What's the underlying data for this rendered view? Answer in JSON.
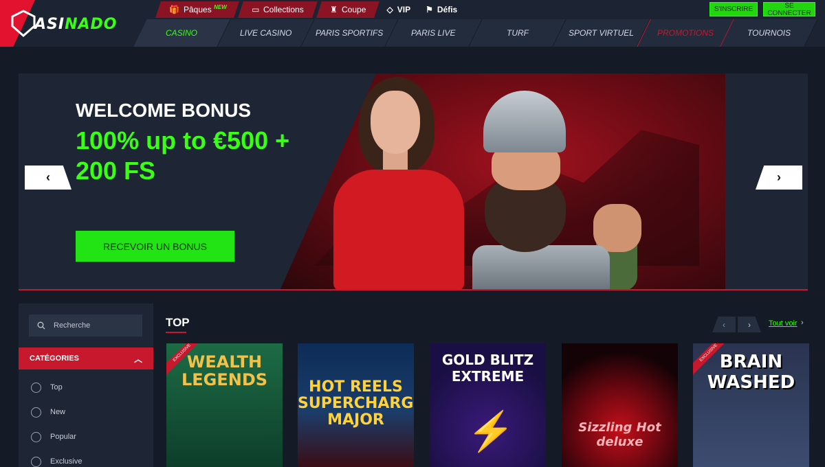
{
  "brand": {
    "logo_text_white": "C",
    "logo_text_main": "ASI",
    "logo_text_green": "NADO",
    "accent": "#39ff14",
    "red": "#c8182d"
  },
  "topbar": [
    {
      "label": "Pâques",
      "badge": "NEW",
      "icon": "gift-icon"
    },
    {
      "label": "Collections",
      "icon": "book-icon"
    },
    {
      "label": "Coupe",
      "icon": "trophy-icon"
    }
  ],
  "topplain": [
    {
      "label": "VIP",
      "icon": "diamond-icon"
    },
    {
      "label": "Défis",
      "icon": "flag-icon"
    }
  ],
  "auth": {
    "signup": "S'INSCRIRE",
    "login": "SE CONNECTER"
  },
  "nav": [
    "CASINO",
    "LIVE CASINO",
    "PARIS SPORTIFS",
    "PARIS LIVE",
    "TURF",
    "SPORT VIRTUEL",
    "PROMOTIONS",
    "TOURNOIS"
  ],
  "banner": {
    "title": "WELCOME BONUS",
    "offer": "100% up to €500 + 200 FS",
    "cta": "RECEVOIR UN BONUS",
    "prev": "‹",
    "next": "›",
    "active_slide": 1,
    "slides": 3
  },
  "sidebar": {
    "search_placeholder": "Recherche",
    "categories_label": "CATÉGORIES",
    "items": [
      "Top",
      "New",
      "Popular",
      "Exclusive"
    ]
  },
  "games": {
    "section_title": "TOP",
    "see_all": "Tout voir",
    "items": [
      {
        "title": "WEALTH LEGENDS",
        "ribbon": "EXCLUSIVE"
      },
      {
        "title": "HOT REELS SUPERCHARGED MAJOR",
        "ribbon": ""
      },
      {
        "title": "GOLD BLITZ EXTREME",
        "ribbon": ""
      },
      {
        "title": "Sizzling Hot deluxe",
        "ribbon": ""
      },
      {
        "title": "BRAIN WASHED",
        "ribbon": "EXCLUSIVE"
      }
    ]
  }
}
